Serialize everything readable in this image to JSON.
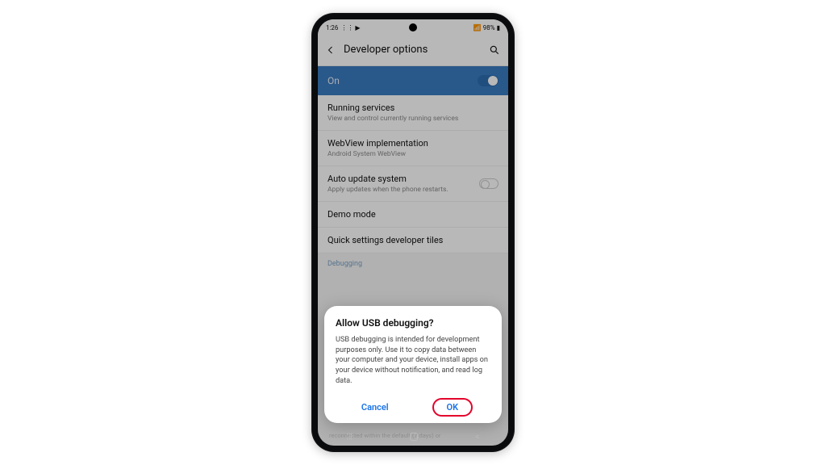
{
  "status": {
    "time": "1:26",
    "battery": "98%"
  },
  "appbar": {
    "title": "Developer options"
  },
  "master_toggle": {
    "label": "On"
  },
  "items": [
    {
      "title": "Running services",
      "subtitle": "View and control currently running services"
    },
    {
      "title": "WebView implementation",
      "subtitle": "Android System WebView"
    },
    {
      "title": "Auto update system",
      "subtitle": "Apply updates when the phone restarts."
    },
    {
      "title": "Demo mode",
      "subtitle": ""
    },
    {
      "title": "Quick settings developer tiles",
      "subtitle": ""
    }
  ],
  "section": {
    "label": "Debugging"
  },
  "peek_text": "reconnected within the default (7 days) or",
  "dialog": {
    "title": "Allow USB debugging?",
    "body": "USB debugging is intended for development purposes only. Use it to copy data between your computer and your device, install apps on your device without notification, and read log data.",
    "cancel": "Cancel",
    "ok": "OK"
  }
}
